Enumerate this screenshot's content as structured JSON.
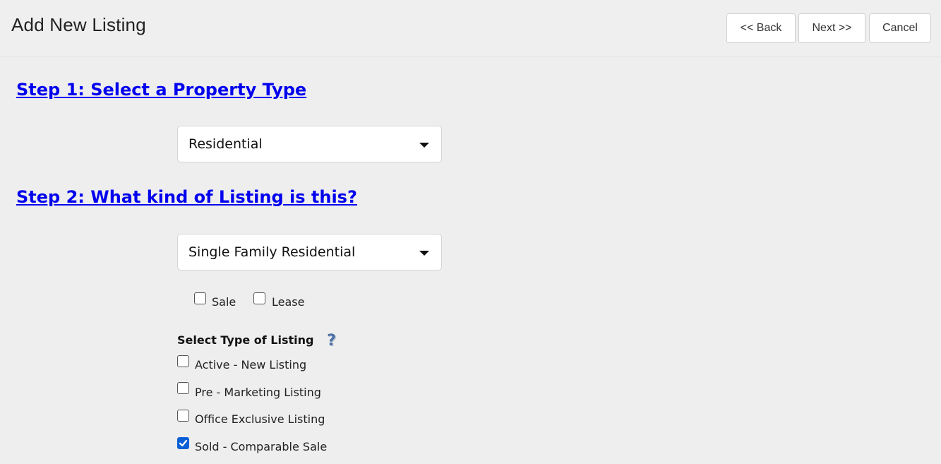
{
  "header": {
    "title": "Add New Listing",
    "back_label": "<< Back",
    "next_label": "Next >>",
    "cancel_label": "Cancel"
  },
  "step1": {
    "heading": "Step 1: Select a Property Type",
    "selected": "Residential"
  },
  "step2": {
    "heading": "Step 2: What kind of Listing is this?",
    "selected": "Single Family Residential",
    "transaction": [
      {
        "label": "Sale",
        "checked": false
      },
      {
        "label": "Lease",
        "checked": false
      }
    ],
    "listing_type_label": "Select Type of Listing",
    "help_icon": "question-mark-icon",
    "listing_types": [
      {
        "label": "Active - New Listing",
        "checked": false
      },
      {
        "label": "Pre - Marketing Listing",
        "checked": false
      },
      {
        "label": "Office Exclusive Listing",
        "checked": false
      },
      {
        "label": "Sold - Comparable Sale",
        "checked": true
      }
    ]
  },
  "colors": {
    "link": "#0000ee",
    "checkbox_checked": "#0b5fd6",
    "help_icon": "#4a6fa5"
  }
}
